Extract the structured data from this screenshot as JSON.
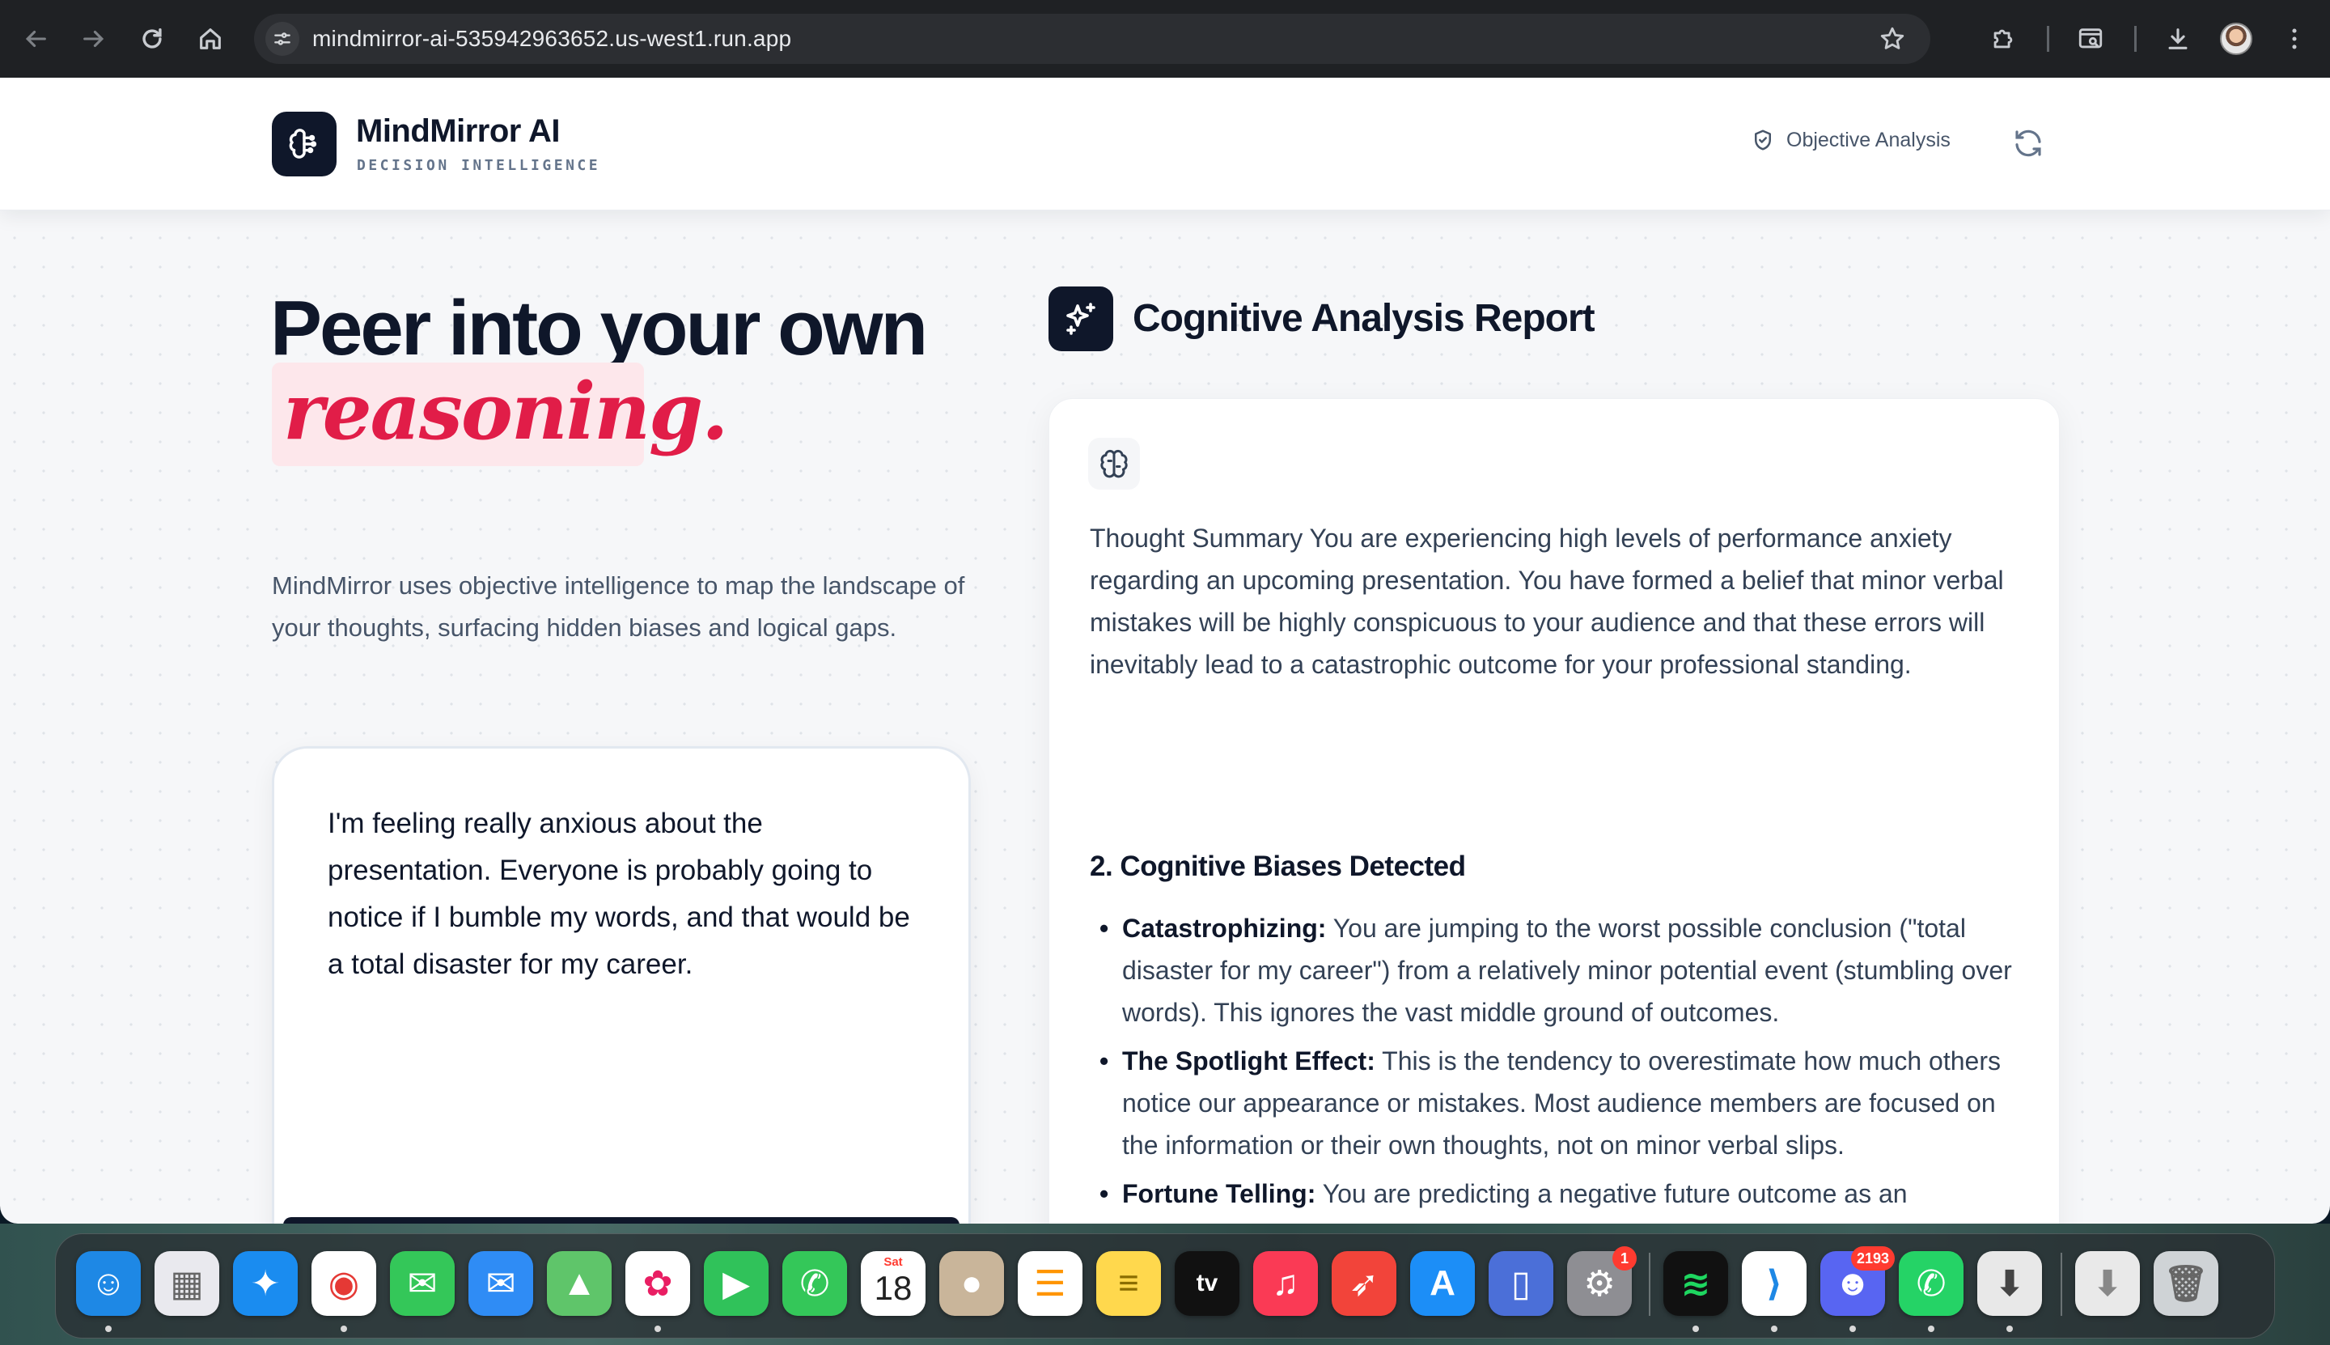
{
  "browser": {
    "url": "mindmirror-ai-535942963652.us-west1.run.app"
  },
  "header": {
    "brand_name": "MindMirror AI",
    "brand_subtitle": "DECISION INTELLIGENCE",
    "objective_label": "Objective Analysis"
  },
  "hero": {
    "line1": "Peer into your own",
    "line2": "reasoning.",
    "description": "MindMirror uses objective intelligence to map the landscape of your thoughts, surfacing hidden biases and logical gaps."
  },
  "input": {
    "value": "I'm feeling really anxious about the presentation. Everyone is probably going to notice if I bumble my words, and that would be a total disaster for my career."
  },
  "report": {
    "title": "Cognitive Analysis Report",
    "summary": "Thought Summary You are experiencing high levels of performance anxiety regarding an upcoming presentation. You have formed a belief that minor verbal mistakes will be highly conspicuous to your audience and that these errors will inevitably lead to a catastrophic outcome for your professional standing.",
    "section_heading": "2. Cognitive Biases Detected",
    "biases": [
      {
        "name": "Catastrophizing:",
        "text": " You are jumping to the worst possible conclusion (\"total disaster for my career\") from a relatively minor potential event (stumbling over words). This ignores the vast middle ground of outcomes."
      },
      {
        "name": "The Spotlight Effect:",
        "text": " This is the tendency to overestimate how much others notice our appearance or mistakes. Most audience members are focused on the information or their own thoughts, not on minor verbal slips."
      },
      {
        "name": "Fortune Telling:",
        "text": " You are predicting a negative future outcome as an established fact without considering more likely, neutral, or positive"
      }
    ]
  },
  "dock": {
    "calendar_month": "Sat",
    "calendar_day": "18",
    "settings_badge": "1",
    "discord_badge": "2193",
    "apps": [
      {
        "name": "finder",
        "color": "#1e88e5"
      },
      {
        "name": "launchpad",
        "color": "#e9e9ee"
      },
      {
        "name": "safari",
        "color": "#1a8cf0"
      },
      {
        "name": "chrome",
        "color": "#ffffff"
      },
      {
        "name": "messages",
        "color": "#34c759"
      },
      {
        "name": "mail",
        "color": "#2f8cf5"
      },
      {
        "name": "maps",
        "color": "#5fc56a"
      },
      {
        "name": "photos",
        "color": "#ffffff"
      },
      {
        "name": "facetime",
        "color": "#30c25a"
      },
      {
        "name": "phone",
        "color": "#34c759"
      },
      {
        "name": "calendar",
        "color": "#ffffff"
      },
      {
        "name": "contacts",
        "color": "#c9b59a"
      },
      {
        "name": "reminders",
        "color": "#ffffff"
      },
      {
        "name": "notes",
        "color": "#ffd84d"
      },
      {
        "name": "apple-tv",
        "color": "#111111"
      },
      {
        "name": "music",
        "color": "#fa3a55"
      },
      {
        "name": "rocket",
        "color": "#f2443a"
      },
      {
        "name": "app-store",
        "color": "#1c8ef7"
      },
      {
        "name": "simulator",
        "color": "#4b6fd8"
      },
      {
        "name": "system-settings",
        "color": "#8e8e93"
      },
      {
        "name": "spotify",
        "color": "#111111"
      },
      {
        "name": "vscode",
        "color": "#ffffff"
      },
      {
        "name": "discord",
        "color": "#5865f2"
      },
      {
        "name": "whatsapp",
        "color": "#25d366"
      },
      {
        "name": "installer",
        "color": "#e8e8e8"
      },
      {
        "name": "downloads-stack",
        "color": "#e9e9e9"
      },
      {
        "name": "trash",
        "color": "#cfd3d6"
      }
    ]
  }
}
